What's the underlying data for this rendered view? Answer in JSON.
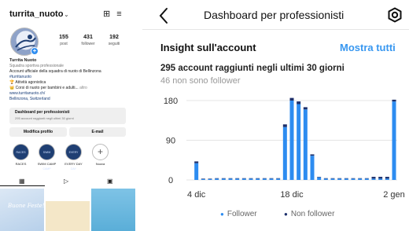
{
  "profile": {
    "username": "turrita_nuoto",
    "stats": [
      {
        "value": "155",
        "label": "post"
      },
      {
        "value": "431",
        "label": "follower"
      },
      {
        "value": "192",
        "label": "seguiti"
      }
    ],
    "name": "Turrita Nuoto",
    "category": "Squadra sportiva professionale",
    "bio_line1": "Account ufficiale della squadra di nuoto di Bellinzona",
    "hashtag": "#turritanuoto",
    "bio_line3": "🏆 Attività agonistica",
    "bio_line4": "👑 Corsi di nuoto per bambini e adulti...",
    "more": "altro",
    "website": "www.turritanuoto.ch/",
    "location": "Bellinzona, Switzerland",
    "dashboard_title": "Dashboard per professionisti",
    "dashboard_sub": "295 account raggiunti negli ultimi 30 giorni",
    "edit_button": "Modifica profilo",
    "email_button": "E-mail",
    "highlights": [
      {
        "label": "RACES",
        "cover": "RACES"
      },
      {
        "label": "SWIM CAMP",
        "cover": "SWIM CAMP"
      },
      {
        "label": "EVERY DAY",
        "cover": "EVERY DAY"
      },
      {
        "label": "Nuova",
        "cover": "+"
      }
    ],
    "thumb_text": "Buone Feste!"
  },
  "insights": {
    "title": "Dashboard per professionisti",
    "section_title": "Insight sull'account",
    "show_all": "Mostra tutti",
    "reach": "295 account raggiunti negli ultimi 30 giorni",
    "non_followers": "46 non sono follower",
    "legend_follower": "Follower",
    "legend_nonfollower": "Non follower"
  },
  "chart_data": {
    "type": "bar",
    "stacked": true,
    "x_tick_labels": [
      "4 dic",
      "18 dic",
      "2 gen"
    ],
    "y_ticks": [
      0,
      90,
      180
    ],
    "ylim": [
      0,
      180
    ],
    "categories": [
      "3 dic",
      "4 dic",
      "5 dic",
      "6 dic",
      "7 dic",
      "8 dic",
      "9 dic",
      "10 dic",
      "11 dic",
      "12 dic",
      "13 dic",
      "14 dic",
      "15 dic",
      "16 dic",
      "17 dic",
      "18 dic",
      "19 dic",
      "20 dic",
      "21 dic",
      "22 dic",
      "23 dic",
      "24 dic",
      "25 dic",
      "26 dic",
      "27 dic",
      "28 dic",
      "29 dic",
      "30 dic",
      "31 dic",
      "1 gen",
      "2 gen"
    ],
    "series": [
      {
        "name": "Follower",
        "color": "#2d8cf0",
        "values": [
          0,
          38,
          2,
          2,
          3,
          3,
          3,
          3,
          3,
          3,
          3,
          3,
          3,
          3,
          120,
          180,
          172,
          160,
          55,
          6,
          3,
          3,
          3,
          3,
          3,
          3,
          3,
          3,
          3,
          3,
          178
        ]
      },
      {
        "name": "Non follower",
        "color": "#1c2f6b",
        "values": [
          0,
          4,
          1,
          1,
          1,
          1,
          1,
          1,
          1,
          1,
          1,
          1,
          1,
          1,
          6,
          6,
          6,
          5,
          3,
          1,
          1,
          1,
          1,
          1,
          1,
          1,
          1,
          4,
          4,
          4,
          4
        ]
      }
    ],
    "grid": "horizontal",
    "legend": "bottom"
  }
}
